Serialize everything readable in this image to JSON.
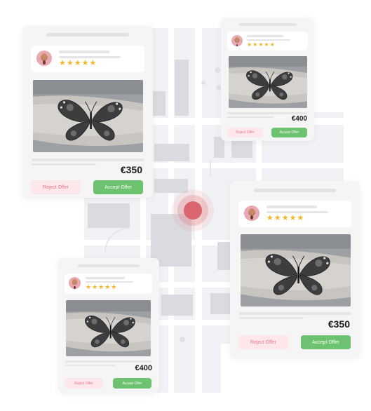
{
  "marker": {
    "color": "#d9656d"
  },
  "colors": {
    "accept": "#6cc26e",
    "reject_bg": "#fde7ea",
    "reject_text": "#e57a88",
    "star": "#f5b72a"
  },
  "offers": [
    {
      "stars": "★★★★★",
      "rating": 5,
      "price": "€350",
      "reject_label": "Reject Offer",
      "accept_label": "Accept Offer",
      "image": "butterfly-tattoo"
    },
    {
      "stars": "★★★★★",
      "rating": 5,
      "price": "€400",
      "reject_label": "Reject Offer",
      "accept_label": "Accept Offer",
      "image": "butterfly-tattoo"
    },
    {
      "stars": "★★★★★",
      "rating": 5,
      "price": "€350",
      "reject_label": "Reject Offer",
      "accept_label": "Accept Offer",
      "image": "butterfly-tattoo"
    },
    {
      "stars": "★★★★★",
      "rating": 5,
      "price": "€400",
      "reject_label": "Reject Offer",
      "accept_label": "Accept Offer",
      "image": "butterfly-tattoo"
    }
  ]
}
